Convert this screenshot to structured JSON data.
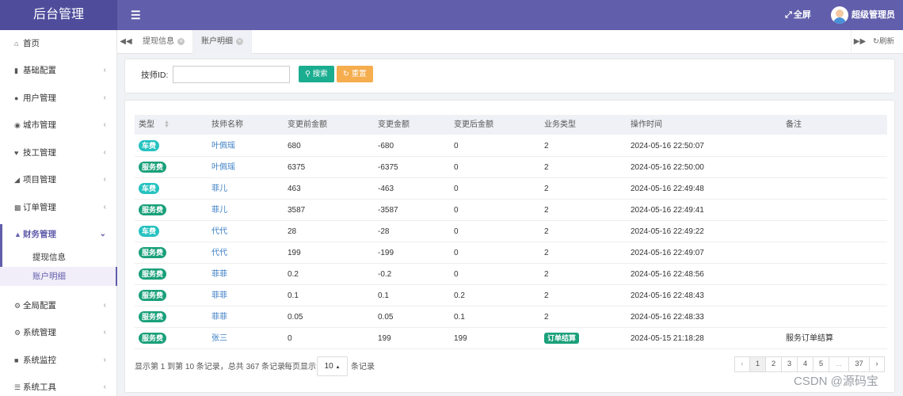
{
  "app_title": "后台管理",
  "header": {
    "menu_icon": "hamburger-icon",
    "fullscreen_label": "全屏",
    "user_name": "超级管理员"
  },
  "sidebar": {
    "items": [
      {
        "label": "首页",
        "icon": "home-icon"
      },
      {
        "label": "基础配置",
        "icon": "bookmark-icon"
      },
      {
        "label": "用户管理",
        "icon": "user-icon"
      },
      {
        "label": "城市管理",
        "icon": "globe-icon"
      },
      {
        "label": "技工管理",
        "icon": "heart-icon"
      },
      {
        "label": "项目管理",
        "icon": "tag-icon"
      },
      {
        "label": "订单管理",
        "icon": "bar-chart-icon"
      },
      {
        "label": "财务管理",
        "icon": "area-chart-icon"
      },
      {
        "label": "全局配置",
        "icon": "gears-icon"
      },
      {
        "label": "系统管理",
        "icon": "gear-icon"
      },
      {
        "label": "系统监控",
        "icon": "video-icon"
      },
      {
        "label": "系统工具",
        "icon": "list-icon"
      }
    ],
    "subitems": [
      {
        "label": "提现信息"
      },
      {
        "label": "账户明细"
      }
    ]
  },
  "tabs": {
    "items": [
      {
        "label": "提现信息"
      },
      {
        "label": "账户明细"
      }
    ],
    "refresh_label": "刷新"
  },
  "search": {
    "label": "技师ID:",
    "input_value": "",
    "search_button": "搜索",
    "reset_button": "重置"
  },
  "table": {
    "columns": [
      "类型",
      "技师名称",
      "变更前金额",
      "变更金额",
      "变更后金额",
      "业务类型",
      "操作时间",
      "备注"
    ],
    "rows": [
      {
        "type": "车费",
        "name": "叶佩瑶",
        "before": "680",
        "change": "-680",
        "after": "0",
        "biz": "2",
        "time": "2024-05-16 22:50:07",
        "note": ""
      },
      {
        "type": "服务费",
        "name": "叶佩瑶",
        "before": "6375",
        "change": "-6375",
        "after": "0",
        "biz": "2",
        "time": "2024-05-16 22:50:00",
        "note": ""
      },
      {
        "type": "车费",
        "name": "菲儿",
        "before": "463",
        "change": "-463",
        "after": "0",
        "biz": "2",
        "time": "2024-05-16 22:49:48",
        "note": ""
      },
      {
        "type": "服务费",
        "name": "菲儿",
        "before": "3587",
        "change": "-3587",
        "after": "0",
        "biz": "2",
        "time": "2024-05-16 22:49:41",
        "note": ""
      },
      {
        "type": "车费",
        "name": "代代",
        "before": "28",
        "change": "-28",
        "after": "0",
        "biz": "2",
        "time": "2024-05-16 22:49:22",
        "note": ""
      },
      {
        "type": "服务费",
        "name": "代代",
        "before": "199",
        "change": "-199",
        "after": "0",
        "biz": "2",
        "time": "2024-05-16 22:49:07",
        "note": ""
      },
      {
        "type": "服务费",
        "name": "菲菲",
        "before": "0.2",
        "change": "-0.2",
        "after": "0",
        "biz": "2",
        "time": "2024-05-16 22:48:56",
        "note": ""
      },
      {
        "type": "服务费",
        "name": "菲菲",
        "before": "0.1",
        "change": "0.1",
        "after": "0.2",
        "biz": "2",
        "time": "2024-05-16 22:48:43",
        "note": ""
      },
      {
        "type": "服务费",
        "name": "菲菲",
        "before": "0.05",
        "change": "0.05",
        "after": "0.1",
        "biz": "2",
        "time": "2024-05-16 22:48:33",
        "note": ""
      },
      {
        "type": "服务费",
        "name": "张三",
        "before": "0",
        "change": "199",
        "after": "199",
        "biz": "订单结算",
        "time": "2024-05-15 21:18:28",
        "note": "服务订单结算"
      }
    ]
  },
  "pagination": {
    "info": "显示第 1 到第 10 条记录，总共 367 条记录",
    "per_page_prefix": "每页显示",
    "per_page_value": "10",
    "per_page_suffix": "条记录",
    "pages": [
      "‹",
      "1",
      "2",
      "3",
      "4",
      "5",
      "...",
      "37",
      "›"
    ],
    "current_page": "1"
  },
  "watermark": "CSDN @源码宝"
}
